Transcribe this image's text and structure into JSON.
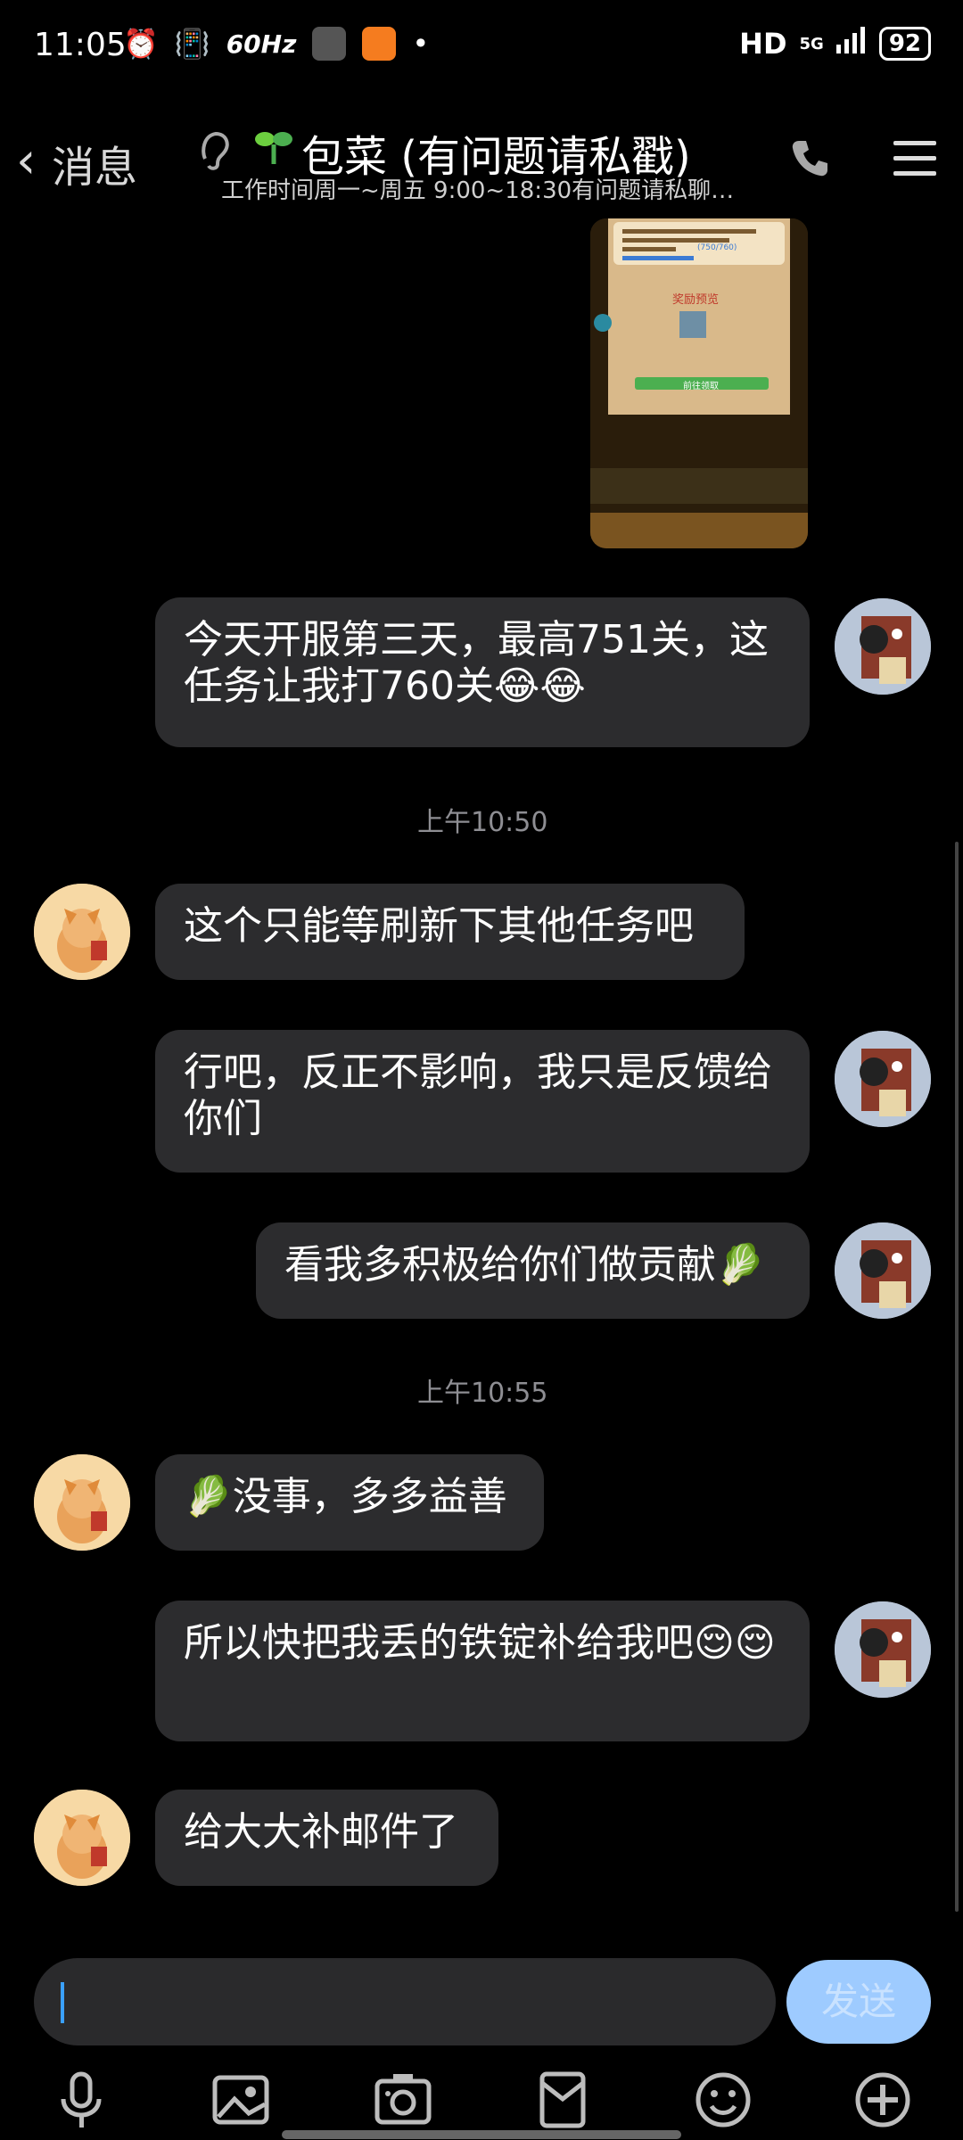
{
  "status": {
    "time": "11:05",
    "refresh": "60Hz",
    "dot": "•",
    "hd": "HD",
    "network": "5G",
    "battery": "92"
  },
  "header": {
    "back_chevron": "‹",
    "back_label": "消息",
    "title": "包菜 (有问题请私戳)",
    "subtitle": "工作时间周一~周五 9:00~18:30有问题请私聊留..."
  },
  "messages": [
    {
      "side": "self",
      "text": "今天开服第三天，最高751关，这任务让我打760关😂😂"
    },
    {
      "timestamp": "上午10:50"
    },
    {
      "side": "other",
      "text": "这个只能等刷新下其他任务吧"
    },
    {
      "side": "self",
      "text": "行吧，反正不影响，我只是反馈给你们"
    },
    {
      "side": "self",
      "text": "看我多积极给你们做贡献🥬"
    },
    {
      "timestamp": "上午10:55"
    },
    {
      "side": "other",
      "text": "🥬没事，多多益善"
    },
    {
      "side": "self",
      "text": "所以快把我丢的铁锭补给我吧😌😌"
    },
    {
      "side": "other",
      "text": "给大大补邮件了"
    }
  ],
  "screenshot_preview": {
    "reward_label": "奖励预览",
    "button_label": "前往领取",
    "progress": "(750/760)"
  },
  "input": {
    "placeholder": "",
    "send_label": "发送"
  },
  "colors": {
    "bubble": "#2c2c2e",
    "send_button": "#9ecbff",
    "cursor": "#3aa0ff",
    "background": "#000000"
  },
  "toolbar": [
    "mic-icon",
    "image-icon",
    "camera-icon",
    "red-packet-icon",
    "emoji-icon",
    "plus-icon"
  ]
}
